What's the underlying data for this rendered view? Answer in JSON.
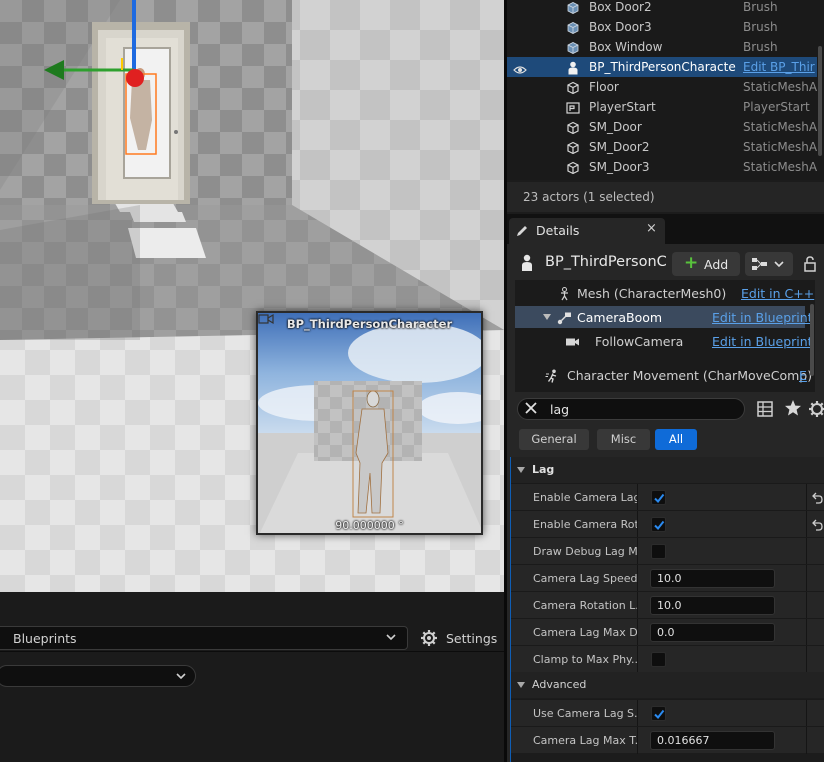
{
  "viewport": {
    "preview": {
      "title": "BP_ThirdPersonCharacter",
      "angle": "90.000000 °"
    }
  },
  "bottom_left": {
    "dropdown_label": "Blueprints",
    "settings_label": "Settings"
  },
  "outliner": {
    "rows": [
      {
        "name": "Box Door2",
        "type": "Brush",
        "icon": "brush-icon"
      },
      {
        "name": "Box Door3",
        "type": "Brush",
        "icon": "brush-icon"
      },
      {
        "name": "Box Window",
        "type": "Brush",
        "icon": "brush-icon"
      },
      {
        "name": "BP_ThirdPersonCharacte",
        "type": "Edit BP_Thir",
        "icon": "pawn-icon",
        "selected": true
      },
      {
        "name": "Floor",
        "type": "StaticMeshA",
        "icon": "static-mesh-icon"
      },
      {
        "name": "PlayerStart",
        "type": "PlayerStart",
        "icon": "player-start-icon"
      },
      {
        "name": "SM_Door",
        "type": "StaticMeshA",
        "icon": "static-mesh-icon"
      },
      {
        "name": "SM_Door2",
        "type": "StaticMeshA",
        "icon": "static-mesh-icon"
      },
      {
        "name": "SM_Door3",
        "type": "StaticMeshA",
        "icon": "static-mesh-icon"
      }
    ],
    "status": "23 actors (1 selected)"
  },
  "details": {
    "tab_label": "Details",
    "tab_close": "×",
    "actor_name": "BP_ThirdPersonC",
    "add_label": "Add",
    "components": [
      {
        "name": "Mesh (CharacterMesh0)",
        "link": "Edit in C++"
      },
      {
        "name": "CameraBoom",
        "link": "Edit in Blueprint",
        "selected": true
      },
      {
        "name": "FollowCamera",
        "link": "Edit in Blueprint"
      },
      {
        "name": "Character Movement (CharMoveComp)",
        "link": "E"
      }
    ],
    "search_value": "lag",
    "filter_tabs": [
      {
        "label": "General",
        "active": false
      },
      {
        "label": "Misc",
        "active": false
      },
      {
        "label": "All",
        "active": true
      }
    ],
    "categories": {
      "lag": "Lag",
      "advanced": "Advanced"
    },
    "properties": [
      {
        "label": "Enable Camera Lag",
        "kind": "checkbox",
        "checked": true,
        "reset": true
      },
      {
        "label": "Enable Camera Rot...",
        "kind": "checkbox",
        "checked": true,
        "reset": true
      },
      {
        "label": "Draw Debug Lag M...",
        "kind": "checkbox",
        "checked": false
      },
      {
        "label": "Camera Lag Speed",
        "kind": "number",
        "value": "10.0"
      },
      {
        "label": "Camera Rotation L...",
        "kind": "number",
        "value": "10.0"
      },
      {
        "label": "Camera Lag Max D...",
        "kind": "number",
        "value": "0.0"
      },
      {
        "label": "Clamp to Max Phy...",
        "kind": "checkbox",
        "checked": false
      }
    ],
    "advanced_properties": [
      {
        "label": "Use Camera Lag S...",
        "kind": "checkbox",
        "checked": true
      },
      {
        "label": "Camera Lag Max T...",
        "kind": "number",
        "value": "0.016667"
      }
    ]
  },
  "colors": {
    "accent_blue": "#0f6bd8",
    "link_blue": "#5aa0e8",
    "selected_row": "#1e4a7a",
    "add_green": "#58c23c"
  }
}
